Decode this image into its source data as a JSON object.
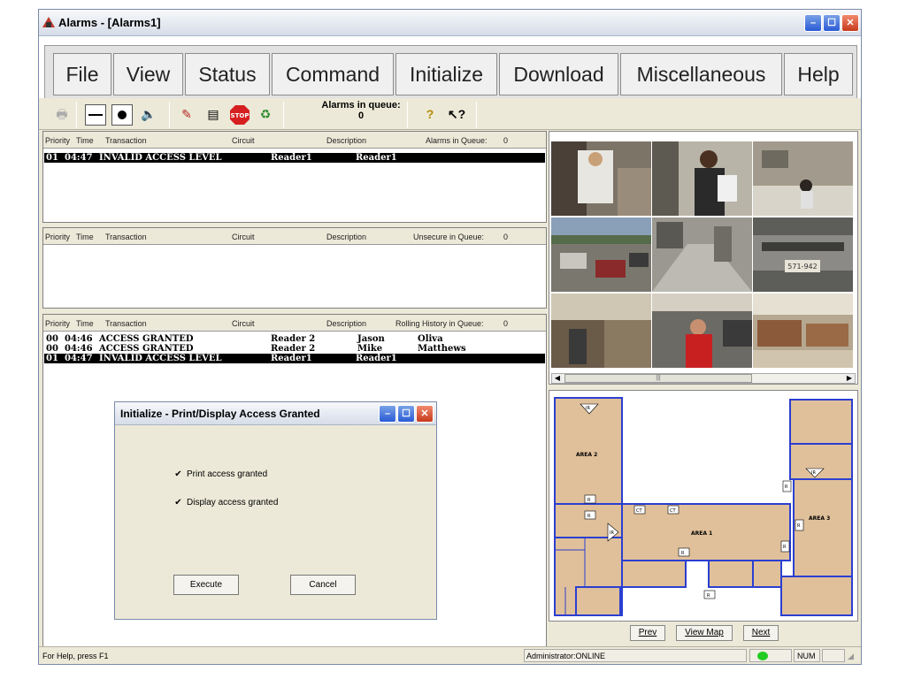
{
  "window": {
    "title": "Alarms - [Alarms1]"
  },
  "menu": [
    "File",
    "View",
    "Status",
    "Command",
    "Initialize",
    "Download",
    "Miscellaneous",
    "Help"
  ],
  "toolbar": {
    "queue_label": "Alarms in queue:",
    "queue_count": "0"
  },
  "alarms_panel": {
    "headers": [
      "Priority",
      "Time",
      "Transaction",
      "Circuit",
      "Description",
      "Alarms in Queue:",
      "0"
    ],
    "rows": [
      {
        "priority": "01",
        "time": "04:47",
        "transaction": "INVALID ACCESS LEVEL",
        "circuit": "Reader1",
        "description": "Reader1",
        "extra": ""
      }
    ]
  },
  "unsecure_panel": {
    "headers": [
      "Priority",
      "Time",
      "Transaction",
      "Circuit",
      "Description",
      "Unsecure in Queue:",
      "0"
    ],
    "rows": []
  },
  "history_panel": {
    "headers": [
      "Priority",
      "Time",
      "Transaction",
      "Circuit",
      "Description",
      "Rolling History in Queue:",
      "0"
    ],
    "rows": [
      {
        "priority": "00",
        "time": "04:46",
        "transaction": "ACCESS GRANTED",
        "circuit": "Reader 2",
        "description": "Jason",
        "extra": "Oliva"
      },
      {
        "priority": "00",
        "time": "04:46",
        "transaction": "ACCESS GRANTED",
        "circuit": "Reader 2",
        "description": "Mike",
        "extra": "Matthews"
      },
      {
        "priority": "01",
        "time": "04:47",
        "transaction": "INVALID ACCESS LEVEL",
        "circuit": "Reader1",
        "description": "Reader1",
        "extra": ""
      }
    ]
  },
  "cameras": {
    "plate_text": "571-942"
  },
  "map": {
    "areas": [
      "AREA 2",
      "AREA 1",
      "AREA 3"
    ],
    "device_labels": [
      "IR",
      "R",
      "CT",
      "IR",
      "R",
      "R",
      "R",
      "IR",
      "R",
      "R",
      "R",
      "CT"
    ]
  },
  "map_nav": {
    "prev": "Prev",
    "view_map": "View Map",
    "next": "Next"
  },
  "dialog": {
    "title": "Initialize - Print/Display Access Granted",
    "option1": "Print access granted",
    "option2": "Display access granted",
    "execute": "Execute",
    "cancel": "Cancel"
  },
  "status": {
    "help": "For Help, press F1",
    "user": "Administrator:ONLINE",
    "num": "NUM"
  },
  "colors": {
    "title_bar": "#d6dde8",
    "selected_row": "#000000",
    "map_fill": "#e0c09a",
    "map_line": "#2b3fd0",
    "online_led": "#22cc22"
  }
}
